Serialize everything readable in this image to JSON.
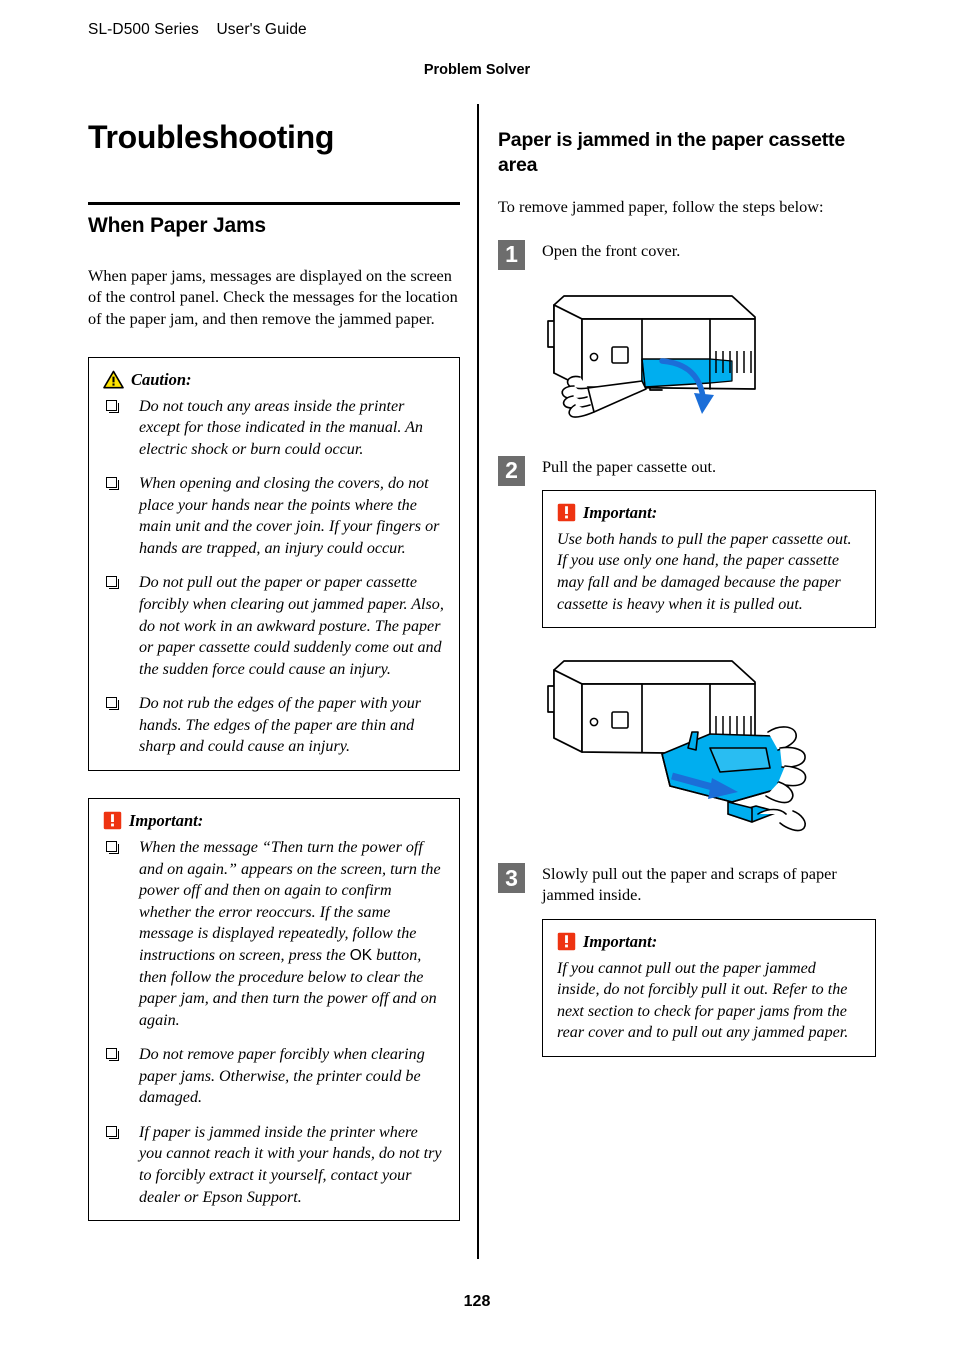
{
  "header": {
    "product": "SL-D500 Series",
    "manual": "User's Guide",
    "chapter": "Problem Solver"
  },
  "footer": {
    "page_number": "128"
  },
  "colors": {
    "caution_icon_fill": "#FFE400",
    "important_icon_fill": "#EE3311",
    "step_badge_bg": "#6D6D6D",
    "illustration_accent": "#00AEEF",
    "illustration_arrow": "#1B6ED8",
    "rule": "#000000"
  },
  "left_column": {
    "doc_title": "Troubleshooting",
    "section_title": "When Paper Jams",
    "intro": "When paper jams, messages are displayed on the screen of the control panel. Check the messages for the location of the paper jam, and then remove the jammed paper.",
    "caution_box": {
      "icon": "caution-triangle-icon",
      "label": "Caution:",
      "items": [
        "Do not touch any areas inside the printer except for those indicated in the manual. An electric shock or burn could occur.",
        "When opening and closing the covers, do not place your hands near the points where the main unit and the cover join. If your fingers or hands are trapped, an injury could occur.",
        "Do not pull out the paper or paper cassette forcibly when clearing out jammed paper. Also, do not work in an awkward posture. The paper or paper cassette could suddenly come out and the sudden force could cause an injury.",
        "Do not rub the edges of the paper with your hands. The edges of the paper are thin and sharp and could cause an injury."
      ]
    },
    "important_box": {
      "icon": "important-exclamation-icon",
      "label": "Important:",
      "item1_part1": "When the message “Then turn the power off and on again.” appears on the screen, turn the power off and then on again to confirm whether the error reoccurs. If the same message is displayed repeatedly, follow the instructions on screen, press the ",
      "item1_button": "OK",
      "item1_part2": " button, then follow the procedure below to clear the paper jam, and then turn the power off and on again.",
      "items_rest": [
        "Do not remove paper forcibly when clearing paper jams. Otherwise, the printer could be damaged.",
        "If paper is jammed inside the printer where you cannot reach it with your hands, do not try to forcibly extract it yourself, contact your dealer or Epson Support."
      ]
    }
  },
  "right_column": {
    "section_title": "Paper is jammed in the paper cassette area",
    "intro": "To remove jammed paper, follow the steps below:",
    "steps": [
      {
        "number": "1",
        "text": "Open the front cover.",
        "figure": "printer-front-cover-open-illustration"
      },
      {
        "number": "2",
        "text": "Pull the paper cassette out.",
        "important": {
          "icon": "important-exclamation-icon",
          "label": "Important:",
          "body": "Use both hands to pull the paper cassette out. If you use only one hand, the paper cassette may fall and be damaged because the paper cassette is heavy when it is pulled out."
        },
        "figure": "printer-paper-cassette-pull-out-illustration"
      },
      {
        "number": "3",
        "text": "Slowly pull out the paper and scraps of paper jammed inside.",
        "important": {
          "icon": "important-exclamation-icon",
          "label": "Important:",
          "body": "If you cannot pull out the paper jammed inside, do not forcibly pull it out. Refer to the next section to check for paper jams from the rear cover and to pull out any jammed paper."
        }
      }
    ]
  }
}
